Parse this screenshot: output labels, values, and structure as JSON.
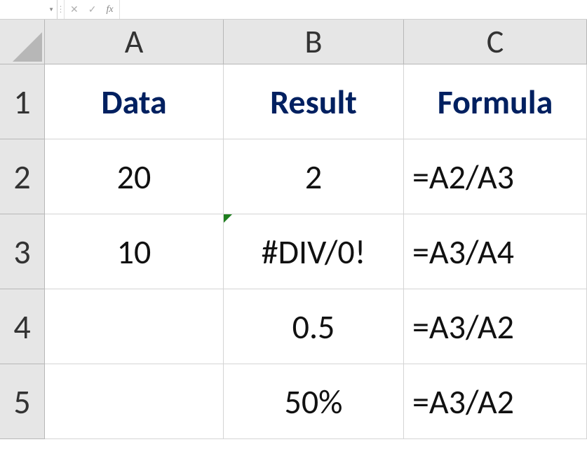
{
  "formula_bar": {
    "name_box": "",
    "cancel_icon": "✕",
    "enter_icon": "✓",
    "fx_label": "fx",
    "formula_text": ""
  },
  "columns": [
    "A",
    "B",
    "C"
  ],
  "rowNumbers": [
    "1",
    "2",
    "3",
    "4",
    "5"
  ],
  "headers": {
    "A": "Data",
    "B": "Result",
    "C": "Formula"
  },
  "rows": [
    {
      "A": "20",
      "B": "2",
      "C": "=A2/A3"
    },
    {
      "A": "10",
      "B": "#DIV/0!",
      "C": "=A3/A4"
    },
    {
      "A": "",
      "B": "0.5",
      "C": "=A3/A2"
    },
    {
      "A": "",
      "B": "50%",
      "C": "=A3/A2"
    }
  ],
  "colors": {
    "header_text": "#002060",
    "grid_fill": "#e6e6e6"
  }
}
